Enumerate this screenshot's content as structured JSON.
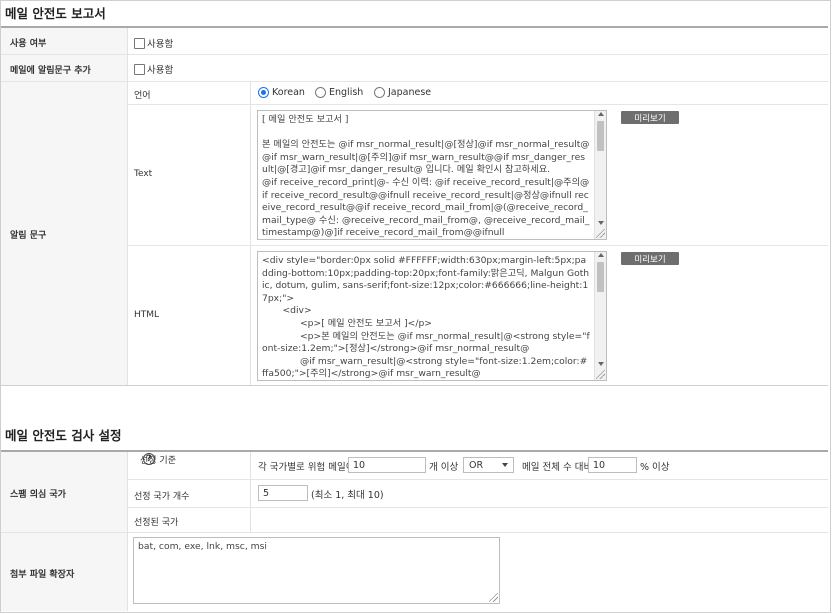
{
  "report": {
    "title": "메일 안전도 보고서",
    "use_label": "사용 여부",
    "use_checkbox": "사용함",
    "notice_label": "메일에 알림문구 추가",
    "notice_checkbox": "사용함",
    "alert_label": "알림 문구",
    "language_label": "언어",
    "languages": [
      "Korean",
      "English",
      "Japanese"
    ],
    "selected_language": "Korean",
    "text_label": "Text",
    "text_content": "[ 메일 안전도 보고서 ]\n\n본 메일의 안전도는 @if msr_normal_result|@[정상]@if msr_normal_result@@if msr_warn_result|@[주의]@if msr_warn_result@@if msr_danger_result|@[경고]@if msr_danger_result@ 입니다. 메일 확인시 참고하세요.\n@if receive_record_print|@- 수신 이력: @if receive_record_result|@주의@if receive_record_result@@ifnull receive_record_result|@정상@ifnull receive_record_result@@if receive_record_mail_from|@(@receive_record_mail_type@ 수신: @receive_record_mail_from@, @receive_record_mail_timestamp@)@]if receive_record_mail_from@@ifnull",
    "html_label": "HTML",
    "html_content": "<div style=\"border:0px solid #FFFFFF;width:630px;margin-left:5px;padding-bottom:10px;padding-top:20px;font-family:맑은고딕, Malgun Gothic, dotum, gulim, sans-serif;font-size:12px;color:#666666;line-height:17px;\">\n       <div>\n             <p>[ 메일 안전도 보고서 ]</p>\n             <p>본 메일의 안전도는 @if msr_normal_result|@<strong style=\"font-size:1.2em;\">[정상]</strong>@if msr_normal_result@\n             @if msr_warn_result|@<strong style=\"font-size:1.2em;color:#ffa500;\">[주의]</strong>@if msr_warn_result@\n             @if msr_danger_result|@<strong style=\"font-",
    "preview_button": "미리보기"
  },
  "check": {
    "title": "메일 안전도 검사 설정",
    "spam_label": "스팸 의심 국가",
    "criteria_label": "선정 기준",
    "criteria_prefix": "각 국가별로 위험 메일이",
    "criteria_count": "10",
    "criteria_mid": "개 이상",
    "criteria_op": "OR",
    "criteria_ratio_prefix": "메일 전체 수 대비",
    "criteria_ratio": "10",
    "criteria_ratio_suffix": "% 이상",
    "country_count_label": "선정 국가 개수",
    "country_count": "5",
    "country_count_hint": "(최소 1, 최대 10)",
    "selected_countries_label": "선정된 국가",
    "attach_label": "첨부 파일 확장자",
    "attach_value": "bat, com, exe, lnk, msc, msi"
  },
  "colors": {
    "radio_accent": "#1a73e8",
    "button_bg": "#6e6e6e",
    "label_bg": "#f6f6f6"
  }
}
